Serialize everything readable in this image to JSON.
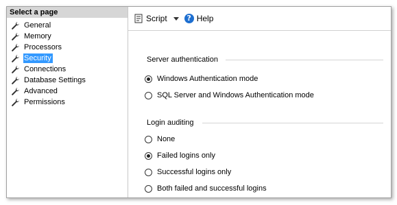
{
  "sidebar": {
    "header": "Select a page",
    "items": [
      {
        "label": "General",
        "icon": "wrench-icon",
        "selected": false
      },
      {
        "label": "Memory",
        "icon": "wrench-icon",
        "selected": false
      },
      {
        "label": "Processors",
        "icon": "wrench-icon",
        "selected": false
      },
      {
        "label": "Security",
        "icon": "wrench-icon",
        "selected": true
      },
      {
        "label": "Connections",
        "icon": "wrench-icon",
        "selected": false
      },
      {
        "label": "Database Settings",
        "icon": "wrench-icon",
        "selected": false
      },
      {
        "label": "Advanced",
        "icon": "wrench-icon",
        "selected": false
      },
      {
        "label": "Permissions",
        "icon": "wrench-icon",
        "selected": false
      }
    ]
  },
  "toolbar": {
    "script_label": "Script",
    "help_label": "Help",
    "help_glyph": "?"
  },
  "server_auth": {
    "title": "Server authentication",
    "options": [
      {
        "label": "Windows Authentication mode",
        "checked": true
      },
      {
        "label": "SQL Server and Windows Authentication mode",
        "checked": false
      }
    ]
  },
  "login_auditing": {
    "title": "Login auditing",
    "options": [
      {
        "label": "None",
        "checked": false
      },
      {
        "label": "Failed logins only",
        "checked": true
      },
      {
        "label": "Successful logins only",
        "checked": false
      },
      {
        "label": "Both failed and successful logins",
        "checked": false
      }
    ]
  },
  "colors": {
    "selection": "#3399ff",
    "header_bg": "#d6d6d6",
    "help_icon": "#1e6fd0"
  }
}
